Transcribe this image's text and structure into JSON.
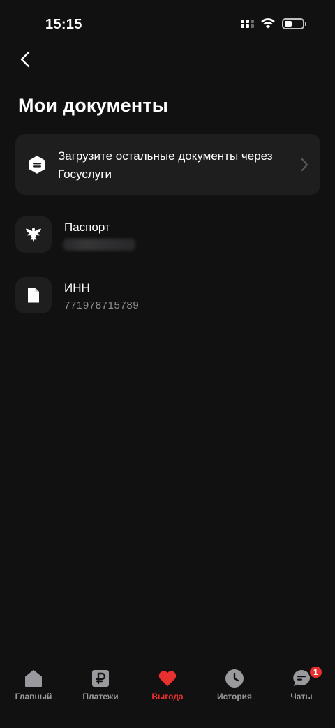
{
  "status_bar": {
    "time": "15:15",
    "icons": [
      "signal-icon",
      "wifi-icon",
      "battery-icon"
    ]
  },
  "header": {
    "back_icon": "chevron-left-icon",
    "title": "Мои документы"
  },
  "banner": {
    "icon": "gosuslugi-icon",
    "text": "Загрузите остальные документы через Госуслуги",
    "chevron_icon": "chevron-right-icon"
  },
  "documents": [
    {
      "title": "Паспорт",
      "subtitle": "",
      "icon": "emblem-icon",
      "subtitle_hidden": true
    },
    {
      "title": "ИНН",
      "subtitle": "771978715789",
      "icon": "document-icon"
    }
  ],
  "tab_bar": {
    "items": [
      {
        "label": "Главный",
        "icon": "home-icon",
        "active": false
      },
      {
        "label": "Платежи",
        "icon": "ruble-icon",
        "active": false
      },
      {
        "label": "Выгода",
        "icon": "heart-icon",
        "active": true
      },
      {
        "label": "История",
        "icon": "clock-icon",
        "active": false
      },
      {
        "label": "Чаты",
        "icon": "chat-icon",
        "active": false,
        "badge": "1"
      }
    ]
  },
  "colors": {
    "background": "#111111",
    "card": "#1e1e1f",
    "accent": "#e8302e",
    "muted_text": "#8e8e93",
    "tab_inactive": "#9a9a9e"
  }
}
